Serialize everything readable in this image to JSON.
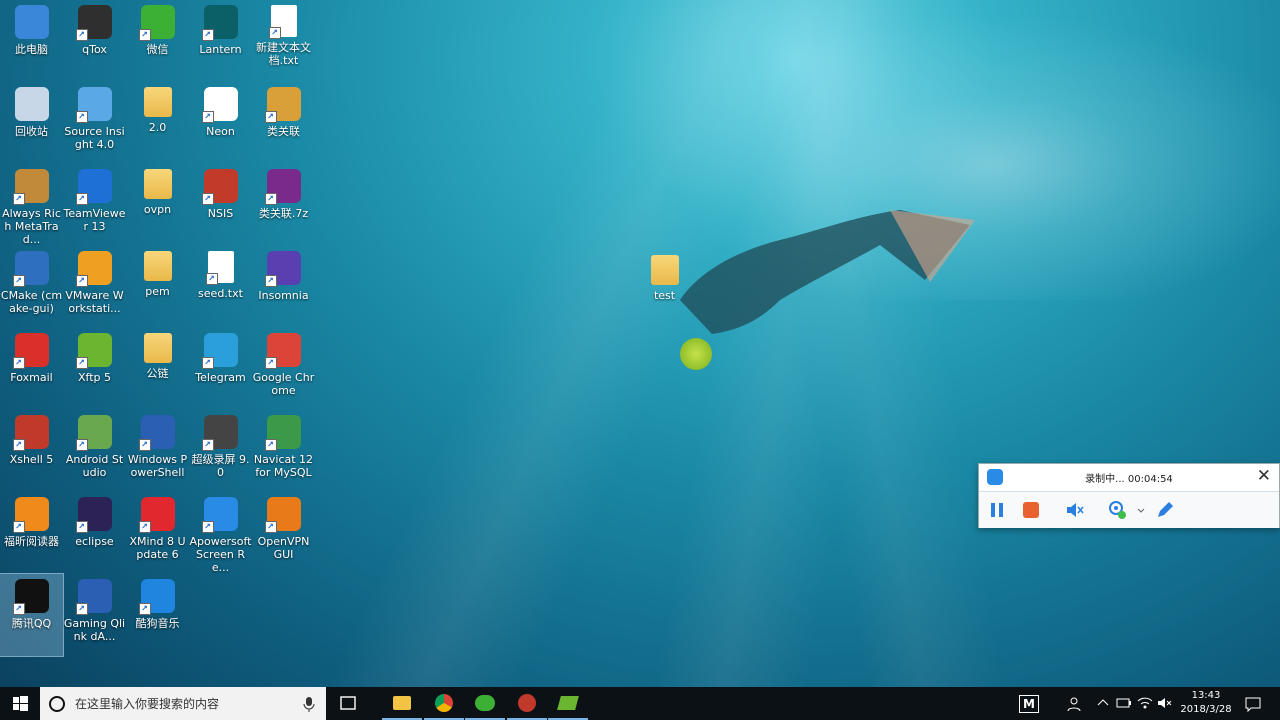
{
  "desktop_icons": [
    {
      "label": "此电脑",
      "glyph": "computer-icon",
      "color": "#3a86d8"
    },
    {
      "label": "qTox",
      "glyph": "qtox-icon",
      "color": "#2f2f2f"
    },
    {
      "label": "微信",
      "glyph": "wechat-icon",
      "color": "#3cb034"
    },
    {
      "label": "Lantern",
      "glyph": "lantern-icon",
      "color": "#0b5f66"
    },
    {
      "label": "新建文本文档.txt",
      "glyph": "text-file-icon",
      "color": "#ffffff"
    },
    {
      "label": "回收站",
      "glyph": "recycle-bin-icon",
      "color": "#c7d7e8"
    },
    {
      "label": "Source Insight 4.0",
      "glyph": "source-insight-icon",
      "color": "#5aa9e6"
    },
    {
      "label": "2.0",
      "glyph": "folder-icon",
      "color": "#e9b94a"
    },
    {
      "label": "Neon",
      "glyph": "neon-icon",
      "color": "#ffffff"
    },
    {
      "label": "类关联",
      "glyph": "archive-icon",
      "color": "#d9a03a"
    },
    {
      "label": "Always Rich MetaTrad...",
      "glyph": "metatrader-icon",
      "color": "#c08a3a"
    },
    {
      "label": "TeamViewer 13",
      "glyph": "teamviewer-icon",
      "color": "#1e6fd6"
    },
    {
      "label": "ovpn",
      "glyph": "folder-icon",
      "color": "#e9b94a"
    },
    {
      "label": "NSIS",
      "glyph": "nsis-icon",
      "color": "#c23a2a"
    },
    {
      "label": "类关联.7z",
      "glyph": "winrar-icon",
      "color": "#7a2a8a"
    },
    {
      "label": "CMake (cmake-gui)",
      "glyph": "cmake-icon",
      "color": "#2f6fc0"
    },
    {
      "label": "VMware Workstati...",
      "glyph": "vmware-icon",
      "color": "#f0a020"
    },
    {
      "label": "pem",
      "glyph": "folder-icon",
      "color": "#e9b94a"
    },
    {
      "label": "seed.txt",
      "glyph": "text-file-icon",
      "color": "#ffffff"
    },
    {
      "label": "Insomnia",
      "glyph": "insomnia-icon",
      "color": "#5a3fb0"
    },
    {
      "label": "Foxmail",
      "glyph": "foxmail-icon",
      "color": "#d9302a"
    },
    {
      "label": "Xftp 5",
      "glyph": "xftp-icon",
      "color": "#6bb531"
    },
    {
      "label": "公链",
      "glyph": "folder-icon",
      "color": "#e9b94a"
    },
    {
      "label": "Telegram",
      "glyph": "telegram-icon",
      "color": "#2a9fd9"
    },
    {
      "label": "Google Chrome",
      "glyph": "chrome-icon",
      "color": "#db4437"
    },
    {
      "label": "Xshell 5",
      "glyph": "xshell-icon",
      "color": "#c0392b"
    },
    {
      "label": "Android Studio",
      "glyph": "android-studio-icon",
      "color": "#6aa84f"
    },
    {
      "label": "Windows PowerShell",
      "glyph": "powershell-icon",
      "color": "#2b5fb4"
    },
    {
      "label": "超级录屏 9.0",
      "glyph": "screen-recorder-icon",
      "color": "#444444"
    },
    {
      "label": "Navicat 12 for MySQL",
      "glyph": "navicat-icon",
      "color": "#3a9a4a"
    },
    {
      "label": "福昕阅读器",
      "glyph": "foxit-pdf-icon",
      "color": "#f08a1a"
    },
    {
      "label": "eclipse",
      "glyph": "eclipse-icon",
      "color": "#2c2255"
    },
    {
      "label": "XMind 8 Update 6",
      "glyph": "xmind-icon",
      "color": "#e0282e"
    },
    {
      "label": "Apowersoft Screen Re...",
      "glyph": "apowersoft-icon",
      "color": "#2a8be6"
    },
    {
      "label": "OpenVPN GUI",
      "glyph": "openvpn-icon",
      "color": "#e87a1a"
    },
    {
      "label": "腾讯QQ",
      "glyph": "qq-icon",
      "color": "#111111"
    },
    {
      "label": "Gaming Qlink dA...",
      "glyph": "word-doc-icon",
      "color": "#2b5fb4"
    },
    {
      "label": "酷狗音乐",
      "glyph": "kugou-icon",
      "color": "#1f86e0"
    }
  ],
  "extra_icon": {
    "label": "test",
    "glyph": "folder-icon",
    "color": "#e9b94a"
  },
  "recorder": {
    "status": "录制中... 00:04:54",
    "pause_label": "pause",
    "stop_label": "stop",
    "mute_label": "mute",
    "webcam_label": "webcam",
    "pen_label": "pen"
  },
  "taskbar": {
    "search_placeholder": "在这里输入你要搜索的内容",
    "pinned": [
      "file-explorer-icon",
      "chrome-icon",
      "wechat-icon",
      "xshell-icon",
      "xftp-icon"
    ],
    "ime": "M",
    "time": "13:43",
    "date": "2018/3/28"
  }
}
